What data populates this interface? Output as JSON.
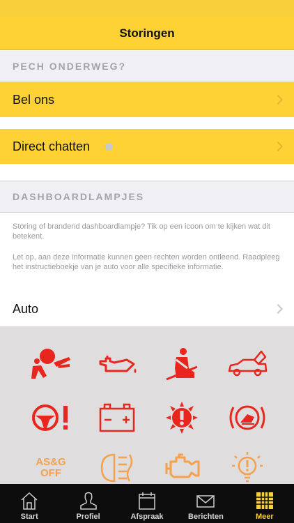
{
  "header": {
    "title": "Storingen"
  },
  "sections": {
    "roadside": "PECH ONDERWEG?",
    "dashboard": "DASHBOARDLAMPJES"
  },
  "rows": {
    "call": "Bel ons",
    "chat": "Direct chatten",
    "brand": "Auto"
  },
  "info": {
    "p1": "Storing of brandend dashboardlampje? Tik op een icoon om te kijken wat dit betekent.",
    "p2": "Let op, aan deze informatie kunnen geen rechten worden ontleend. Raadpleeg het instructieboekje van je auto voor alle specifieke informatie."
  },
  "lamps": {
    "asg_line1": "AS&G",
    "asg_line2": "OFF",
    "items": [
      "airbag-icon",
      "oil-pressure-icon",
      "seatbelt-icon",
      "trunk-open-icon",
      "power-steering-icon",
      "battery-icon",
      "warning-sun-icon",
      "brake-pad-icon",
      "asg-off-icon",
      "fog-light-icon",
      "engine-check-icon",
      "bulb-failure-icon"
    ]
  },
  "colors": {
    "yellow": "#fed235",
    "red": "#e8261d",
    "orange": "#f5a04c"
  },
  "tabs": [
    {
      "label": "Start",
      "icon": "home-icon"
    },
    {
      "label": "Profiel",
      "icon": "person-icon"
    },
    {
      "label": "Afspraak",
      "icon": "calendar-icon"
    },
    {
      "label": "Berichten",
      "icon": "envelope-icon"
    },
    {
      "label": "Meer",
      "icon": "grid-icon",
      "active": true
    }
  ]
}
